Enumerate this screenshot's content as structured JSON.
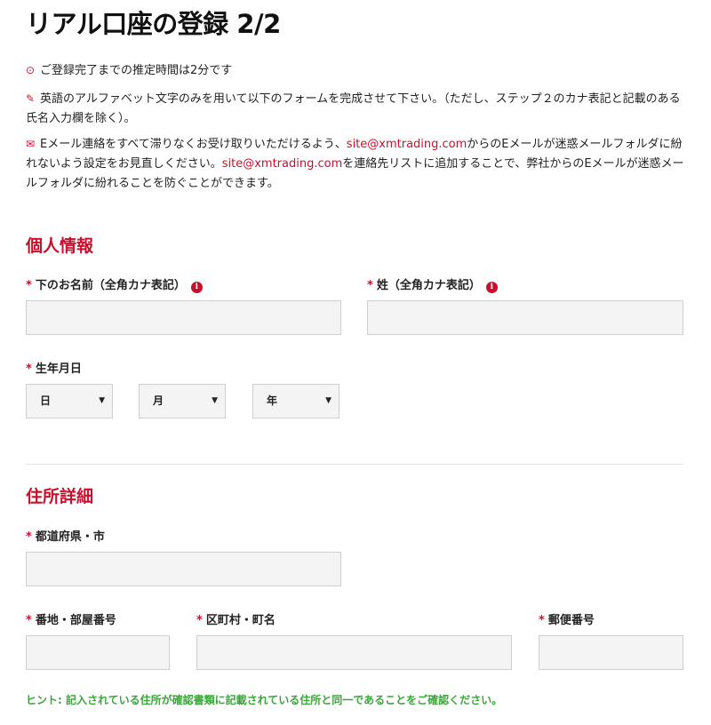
{
  "page": {
    "title": "リアル口座の登録 2/2"
  },
  "notes": {
    "time_estimate": "ご登録完了までの推定時間は2分です",
    "alphabet_instruction": "英語のアルファベット文字のみを用いて以下のフォームを完成させて下さい。（ただし、ステップ２のカナ表記と記載のある氏名入力欄を除く）。",
    "email_part1": "Eメール連絡をすべて滞りなくお受け取りいただけるよう、",
    "email_link1": "site@xmtrading.com",
    "email_part2": "からのEメールが迷惑メールフォルダに紛れないよう設定をお見直しください。",
    "email_link2": "site@xmtrading.com",
    "email_part3": "を連絡先リストに追加することで、弊社からのEメールが迷惑メールフォルダに紛れることを防ぐことができます。"
  },
  "personal": {
    "section_title": "個人情報",
    "first_name_label": "下のお名前（全角カナ表記）",
    "last_name_label": "姓（全角カナ表記）",
    "first_name_value": "",
    "last_name_value": "",
    "birthdate_label": "生年月日",
    "day_select": "日",
    "month_select": "月",
    "year_select": "年",
    "required_mark": "*",
    "info_icon": "i"
  },
  "address": {
    "section_title": "住所詳細",
    "prefecture_label": "都道府県・市",
    "street_label": "番地・部屋番号",
    "city_label": "区町村・町名",
    "postal_label": "郵便番号",
    "prefecture_value": "",
    "street_value": "",
    "city_value": "",
    "postal_value": "",
    "hint": "ヒント: 記入されている住所が確認書類に記載されている住所と同一であることをご確認ください。"
  },
  "icons": {
    "clock": "clock-icon",
    "pencil": "pencil-icon",
    "envelope": "envelope-icon",
    "info": "info-icon",
    "dropdown": "chevron-down-icon"
  },
  "colors": {
    "accent": "#c8102e",
    "hint": "#3aa63a",
    "input_bg": "#f4f4f4"
  }
}
